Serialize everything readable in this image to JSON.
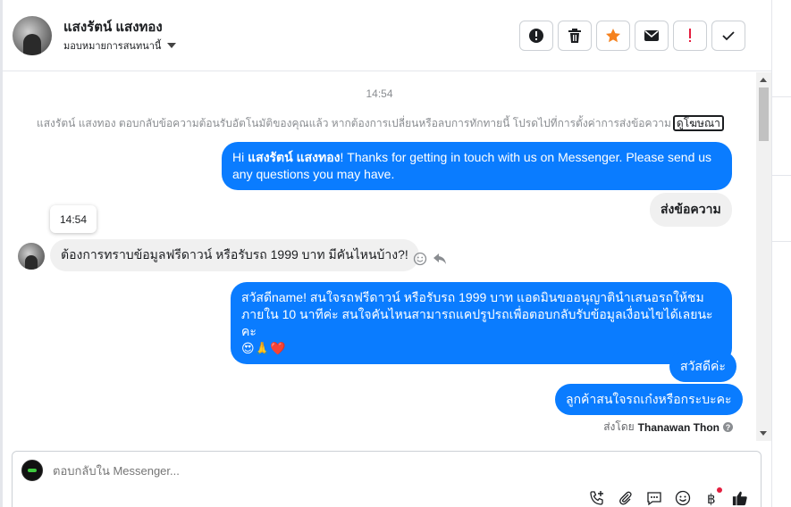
{
  "header": {
    "contact_name": "แสงรัตน์ แสงทอง",
    "assign_label": "มอบหมายการสนทนานี้",
    "actions": [
      {
        "name": "report-button",
        "icon": "alert-circle-icon",
        "color": "#1c1e21"
      },
      {
        "name": "delete-button",
        "icon": "trash-icon",
        "color": "#1c1e21"
      },
      {
        "name": "star-button",
        "icon": "star-icon",
        "color": "#f5821f"
      },
      {
        "name": "mark-unread-button",
        "icon": "envelope-icon",
        "color": "#1c1e21"
      },
      {
        "name": "important-button",
        "icon": "exclamation-icon",
        "color": "#e41e3f"
      },
      {
        "name": "done-button",
        "icon": "check-icon",
        "color": "#1c1e21"
      }
    ]
  },
  "thread": {
    "timestamp": "14:54",
    "system_message": "แสงรัตน์ แสงทอง ตอบกลับข้อความต้อนรับอัตโนมัติของคุณแล้ว หากต้องการเปลี่ยนหรือลบการทักทายนี้ โปรดไปที่การตั้งค่าการส่งข้อความ",
    "system_link": "ดูโฆษณา",
    "welcome_message": {
      "prefix": "Hi ",
      "name": "แสงรัตน์ แสงทอง",
      "suffix": "! Thanks for getting in touch with us on Messenger. Please send us any questions you may have."
    },
    "send_message_button": "ส่งข้อความ",
    "tooltip_time": "14:54",
    "incoming_message": "ต้องการทราบข้อมูลฟรีดาวน์ หรือรับรถ 1999 บาท มีคันไหนบ้าง?!",
    "reply_message_line1": "สวัสดีname! สนใจรถฟรีดาวน์ หรือรับรถ 1999 บาท แอดมินขออนุญาตินำเสนอรถให้ชม",
    "reply_message_line2": "ภายใน 10 นาทีค่ะ สนใจคันไหนสามารถแคปรูปรถเพื่อตอบกลับรับข้อมูลเงื่อนไขได้เลยนะคะ",
    "reply_emojis": "😍🙏❤️",
    "message_hello": "สวัสดีค่ะ",
    "message_question": "ลูกค้าสนใจรถเก๋งหรือกระบะคะ",
    "sent_by_label": "ส่งโดย",
    "sent_by_name": "Thanawan Thon"
  },
  "composer": {
    "placeholder": "ตอบกลับใน Messenger...",
    "tools": [
      "call-add-icon",
      "attachment-icon",
      "saved-reply-icon",
      "emoji-icon",
      "payment-icon",
      "like-icon"
    ]
  },
  "colors": {
    "outgoing_bubble": "#0a7cff",
    "incoming_bubble": "#f0f0f0",
    "star": "#f5821f",
    "important": "#e41e3f"
  }
}
